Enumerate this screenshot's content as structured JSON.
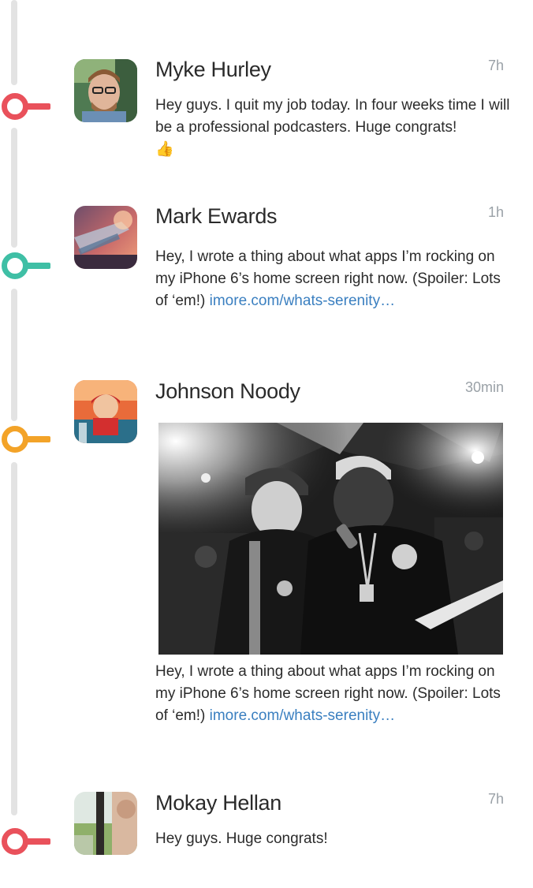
{
  "posts": [
    {
      "name": "Myke Hurley",
      "time": "7h",
      "text": "Hey guys. I quit my job today. In four weeks time I will be a professional podcasters. Huge congrats!",
      "emoji": "👍",
      "accent": "#e9515b"
    },
    {
      "name": "Mark Ewards",
      "time": "1h",
      "text": "Hey, I wrote a thing about what apps I’m rocking on my iPhone 6’s home screen right now. (Spoiler: Lots of ‘em!) ",
      "link": "imore.com/whats-serenity…",
      "accent": "#3fbfa5"
    },
    {
      "name": "Johnson Noody",
      "time": "30min",
      "text": "Hey, I wrote a thing about what apps I’m rocking on my iPhone 6’s home screen right now. (Spoiler: Lots of ‘em!) ",
      "link": "imore.com/whats-serenity…",
      "accent": "#f3a328",
      "photo": "concert-photo"
    },
    {
      "name": "Mokay Hellan",
      "time": "7h",
      "text": "Hey guys. Huge congrats!",
      "accent": "#e9515b"
    }
  ]
}
